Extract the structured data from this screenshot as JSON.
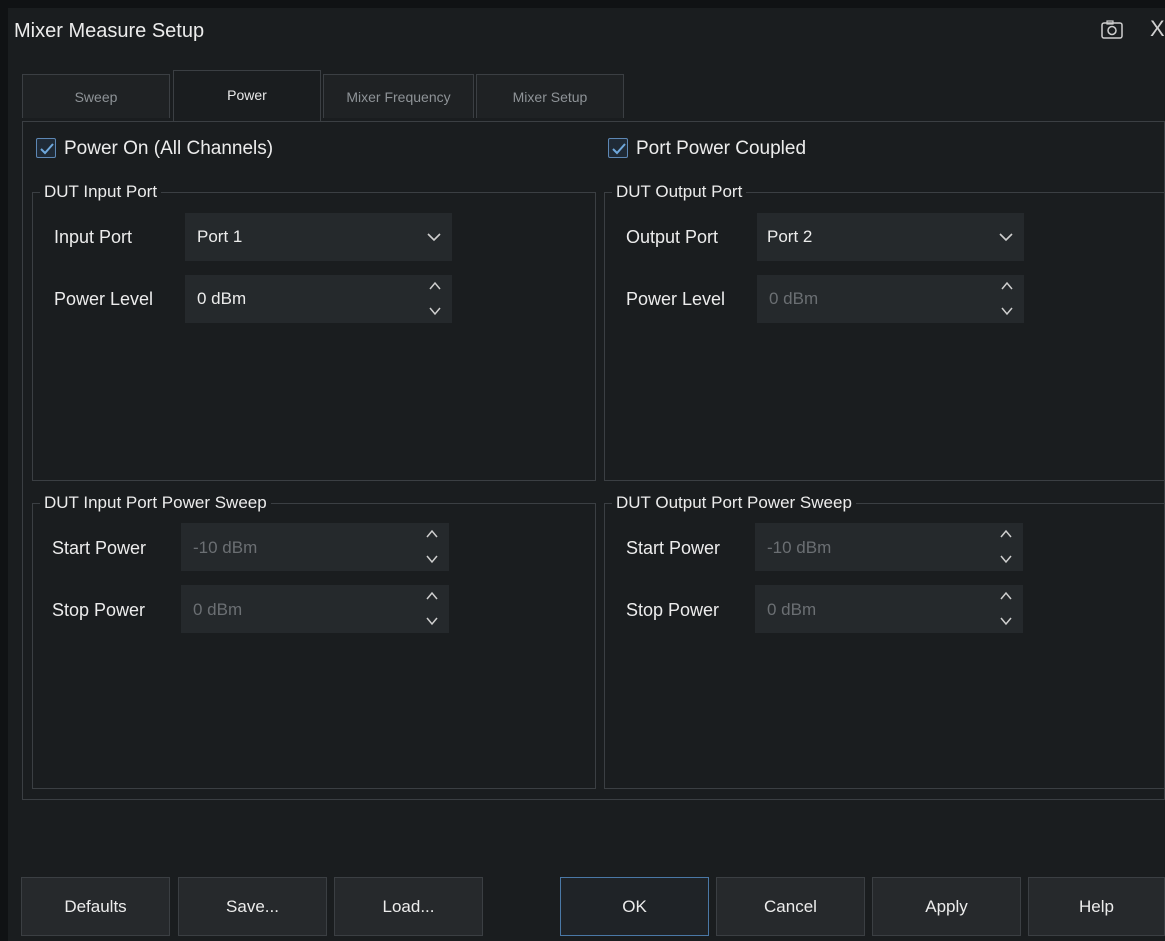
{
  "window": {
    "title": "Mixer Measure Setup",
    "close_glyph": "X",
    "camera_icon": "camera-icon"
  },
  "tabs": [
    {
      "label": "Sweep",
      "active": false
    },
    {
      "label": "Power",
      "active": true
    },
    {
      "label": "Mixer Frequency",
      "active": false
    },
    {
      "label": "Mixer Setup",
      "active": false
    }
  ],
  "power_on": {
    "label": "Power On (All Channels)",
    "checked": true
  },
  "port_power_coupled": {
    "label": "Port Power Coupled",
    "checked": true
  },
  "dut_input": {
    "title": "DUT Input Port",
    "port_label": "Input Port",
    "port_value": "Port 1",
    "level_label": "Power Level",
    "level_value": "0 dBm"
  },
  "dut_output": {
    "title": "DUT Output Port",
    "port_label": "Output Port",
    "port_value": "Port 2",
    "level_label": "Power Level",
    "level_value": "0 dBm"
  },
  "dut_input_sweep": {
    "title": "DUT Input Port Power Sweep",
    "start_label": "Start Power",
    "start_value": "-10 dBm",
    "stop_label": "Stop Power",
    "stop_value": "0 dBm"
  },
  "dut_output_sweep": {
    "title": "DUT Output Port Power Sweep",
    "start_label": "Start Power",
    "start_value": "-10 dBm",
    "stop_label": "Stop Power",
    "stop_value": "0 dBm"
  },
  "buttons": {
    "defaults": "Defaults",
    "save": "Save...",
    "load": "Load...",
    "ok": "OK",
    "cancel": "Cancel",
    "apply": "Apply",
    "help": "Help"
  },
  "colors": {
    "accent": "#4a78a6",
    "check": "#6fa8dc",
    "background": "#1a1d1f"
  }
}
